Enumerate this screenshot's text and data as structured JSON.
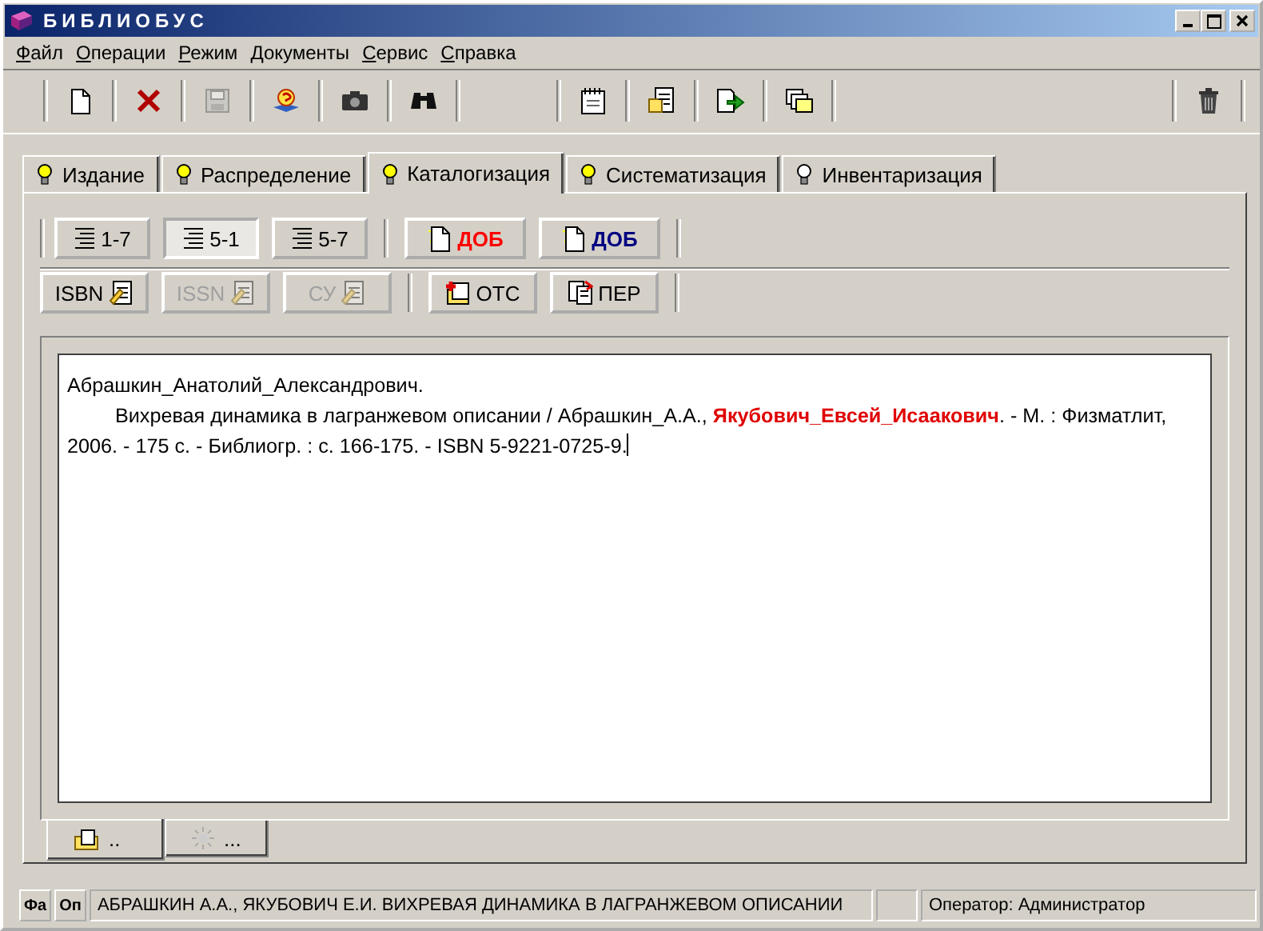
{
  "window": {
    "title": "БИБЛИОБУС"
  },
  "menu": [
    "Файл",
    "Операции",
    "Режим",
    "Документы",
    "Сервис",
    "Справка"
  ],
  "toolbar": [
    {
      "disabled": false
    },
    {
      "disabled": false
    },
    {
      "disabled": true
    },
    {
      "disabled": false
    },
    {
      "disabled": false
    },
    {
      "disabled": false
    },
    {
      "disabled": false
    },
    {
      "disabled": false
    },
    {
      "disabled": false
    },
    {
      "disabled": false
    },
    {
      "disabled": false
    }
  ],
  "tabs": [
    {
      "label": "Издание",
      "selected": false,
      "lit": true
    },
    {
      "label": "Распределение",
      "selected": false,
      "lit": true
    },
    {
      "label": "Каталогизация",
      "selected": true,
      "lit": true
    },
    {
      "label": "Систематизация",
      "selected": false,
      "lit": true
    },
    {
      "label": "Инвентаризация",
      "selected": false,
      "lit": false
    }
  ],
  "format_buttons": [
    {
      "label": "1-7",
      "selected": false
    },
    {
      "label": "5-1",
      "selected": true
    },
    {
      "label": "5-7",
      "selected": false
    }
  ],
  "add_buttons": [
    {
      "label": "ДОБ",
      "color": "#ff0000"
    },
    {
      "label": "ДОБ",
      "color": "#000080"
    }
  ],
  "tool_buttons": [
    {
      "label": "ISBN",
      "disabled": false
    },
    {
      "label": "ISSN",
      "disabled": true
    },
    {
      "label": "СУ",
      "disabled": true
    }
  ],
  "link_buttons": [
    {
      "label": "ОТС"
    },
    {
      "label": "ПЕР"
    }
  ],
  "record": {
    "heading": "Абрашкин_Анатолий_Александрович.",
    "body": [
      {
        "text": "Вихревая динамика в лагранжевом описании / Абрашкин_А.А., ",
        "highlight": false
      },
      {
        "text": "Якубович_Евсей_Исаакович",
        "highlight": true
      },
      {
        "text": ". - М. : Физматлит, 2006. - 175 с. - Библиогр. : с. 166-175. - ISBN 5-9221-0725-9.",
        "highlight": false
      }
    ]
  },
  "bottom_tabs": [
    {
      "label": "..",
      "selected": true
    },
    {
      "label": "...",
      "selected": false
    }
  ],
  "status_bar": {
    "buttons": [
      "Фа",
      "Оп"
    ],
    "title": "АБРАШКИН А.А., ЯКУБОВИЧ Е.И. ВИХРЕВАЯ ДИНАМИКА В ЛАГРАНЖЕВОМ ОПИСАНИИ",
    "operator": "Оператор: Администратор"
  }
}
